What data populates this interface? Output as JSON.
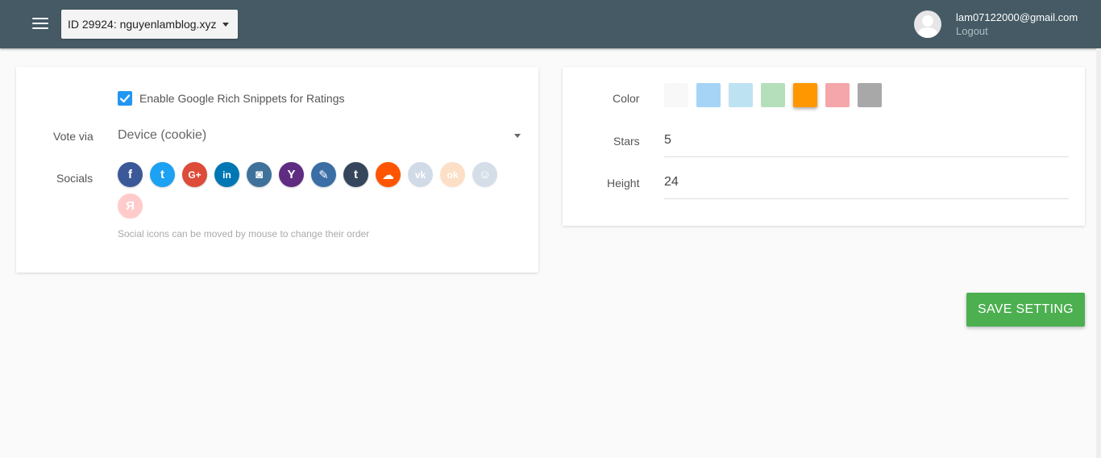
{
  "header": {
    "site_selector": "ID 29924: nguyenlamblog.xyz",
    "user_email": "lam07122000@gmail.com",
    "logout_label": "Logout",
    "bar_color": "#455a64"
  },
  "left_panel": {
    "rich_snippets_label": "Enable Google Rich Snippets for Ratings",
    "rich_snippets_checked": true,
    "vote_via_label": "Vote via",
    "vote_via_value": "Device (cookie)",
    "socials_label": "Socials",
    "socials": [
      {
        "name": "facebook",
        "glyph": "f",
        "color": "#3b5998",
        "enabled": true
      },
      {
        "name": "twitter",
        "glyph": "t",
        "color": "#1da1f2",
        "enabled": true
      },
      {
        "name": "google-plus",
        "glyph": "G+",
        "color": "#dd4b39",
        "enabled": true
      },
      {
        "name": "linkedin",
        "glyph": "in",
        "color": "#0077b5",
        "enabled": true
      },
      {
        "name": "instagram",
        "glyph": "◙",
        "color": "#3f729b",
        "enabled": true
      },
      {
        "name": "yahoo",
        "glyph": "Y",
        "color": "#5f2c82",
        "enabled": true
      },
      {
        "name": "pencil",
        "glyph": "✎",
        "color": "#3a6ea5",
        "enabled": true
      },
      {
        "name": "tumblr",
        "glyph": "t",
        "color": "#35465c",
        "enabled": true
      },
      {
        "name": "soundcloud",
        "glyph": "☁",
        "color": "#ff5500",
        "enabled": true
      },
      {
        "name": "vk",
        "glyph": "vk",
        "color": "#4c75a3",
        "enabled": false
      },
      {
        "name": "odnoklassniki",
        "glyph": "ok",
        "color": "#f58220",
        "enabled": false
      },
      {
        "name": "mail-ru",
        "glyph": "☺",
        "color": "#5b7fa6",
        "enabled": false
      },
      {
        "name": "yandex",
        "glyph": "Я",
        "color": "#ff3333",
        "enabled": false
      }
    ],
    "socials_hint": "Social icons can be moved by mouse to change their order"
  },
  "right_panel": {
    "color_label": "Color",
    "colors": [
      "#f8f8f8",
      "#a6d4f7",
      "#bde3f2",
      "#b5dfbb",
      "#ff9800",
      "#f5a6ab",
      "#a8a8a8"
    ],
    "selected_color": "#ff9800",
    "stars_label": "Stars",
    "stars_value": "5",
    "height_label": "Height",
    "height_value": "24"
  },
  "save_button": "SAVE SETTING",
  "save_button_color": "#4caf50"
}
